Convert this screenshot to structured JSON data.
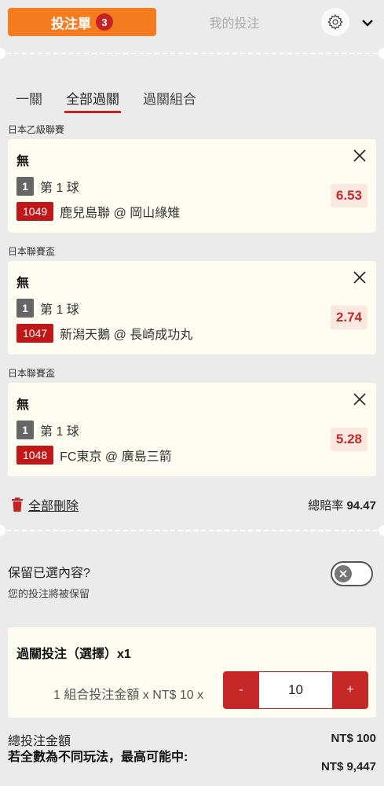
{
  "header": {
    "betslip_label": "投注單",
    "betslip_count": "3",
    "mybets_label": "我的投注"
  },
  "subtabs": [
    "一關",
    "全部過關",
    "過關組合"
  ],
  "active_subtab": "全部過關",
  "bets": [
    {
      "league": "日本乙級聯賽",
      "market": "無",
      "selection_no": "1",
      "selection": "第 1 球",
      "match_id": "1049",
      "match": "鹿兒島聯 @ 岡山綠雉",
      "odds": "6.53"
    },
    {
      "league": "日本聯賽盃",
      "market": "無",
      "selection_no": "1",
      "selection": "第 1 球",
      "match_id": "1047",
      "match": "新潟天鵝 @ 長崎成功丸",
      "odds": "2.74"
    },
    {
      "league": "日本聯賽盃",
      "market": "無",
      "selection_no": "1",
      "selection": "第 1 球",
      "match_id": "1048",
      "match": "FC東京 @ 廣島三箭",
      "odds": "5.28"
    }
  ],
  "actions": {
    "delete_all": "全部刪除",
    "total_odds_label": "總賠率",
    "total_odds_value": "94.47"
  },
  "keep": {
    "title": "保留已選內容?",
    "subtitle": "您的投注將被保留"
  },
  "multi": {
    "title": "過關投注（選擇）x1",
    "formula": "1 組合投注金額 x NT$ 10 x",
    "minus": "-",
    "plus": "+",
    "stake": "10"
  },
  "summary": {
    "total_stake_label": "總投注金額",
    "total_stake_value": "NT$ 100",
    "max_win_label": "若全數為不同玩法，最高可能中:",
    "max_win_value": "NT$ 9,447"
  },
  "colors": {
    "accent": "#f47b20",
    "red": "#c62222",
    "card": "#fffdf2",
    "bg": "#ebebeb"
  }
}
